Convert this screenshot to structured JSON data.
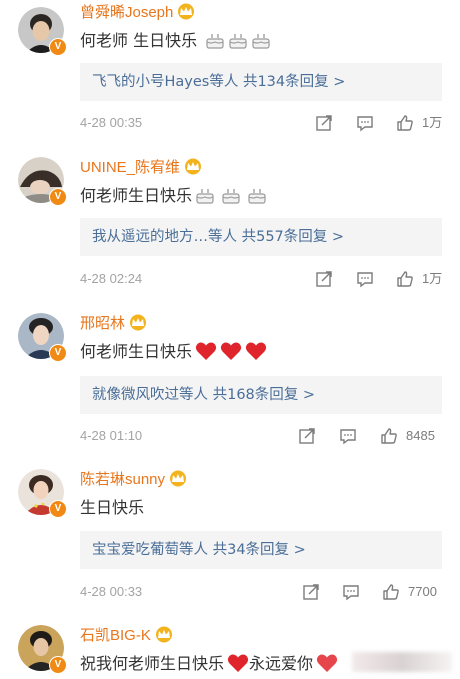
{
  "comments": [
    {
      "name": "曾舜晞Joseph",
      "text": "何老师 生日快乐",
      "emojis": [
        "cake-icon",
        "cake-icon",
        "cake-icon"
      ],
      "replies_label": "飞飞的小号Hayes等人  共134条回复 >",
      "time": "4-28 00:35",
      "likes": "1万"
    },
    {
      "name": "UNINE_陈宥维",
      "text": "何老师生日快乐",
      "emojis": [
        "cake-icon",
        "cake-icon",
        "cake-icon"
      ],
      "replies_label": "我从遥远的地方…等人  共557条回复 >",
      "time": "4-28 02:24",
      "likes": "1万"
    },
    {
      "name": "邢昭林",
      "text": "何老师生日快乐",
      "emojis": [
        "heart-icon",
        "heart-icon",
        "heart-icon"
      ],
      "replies_label": "就像微风吹过等人  共168条回复 >",
      "time": "4-28 01:10",
      "likes": "8485"
    },
    {
      "name": "陈若琳sunny",
      "text": "生日快乐",
      "emojis": [],
      "replies_label": "宝宝爱吃葡萄等人  共34条回复 >",
      "time": "4-28 00:33",
      "likes": "7700"
    },
    {
      "name": "石凯BIG-K",
      "text": "祝我何老师生日快乐",
      "text2": "永远爱你",
      "emojis": [
        "heart-icon",
        "heart-icon"
      ]
    }
  ],
  "colors": {
    "name": "#e8761c",
    "reply_link": "#4a6e98",
    "meta": "#a3a3a3",
    "heart": "#e0242b",
    "badge": "#f08a14"
  }
}
